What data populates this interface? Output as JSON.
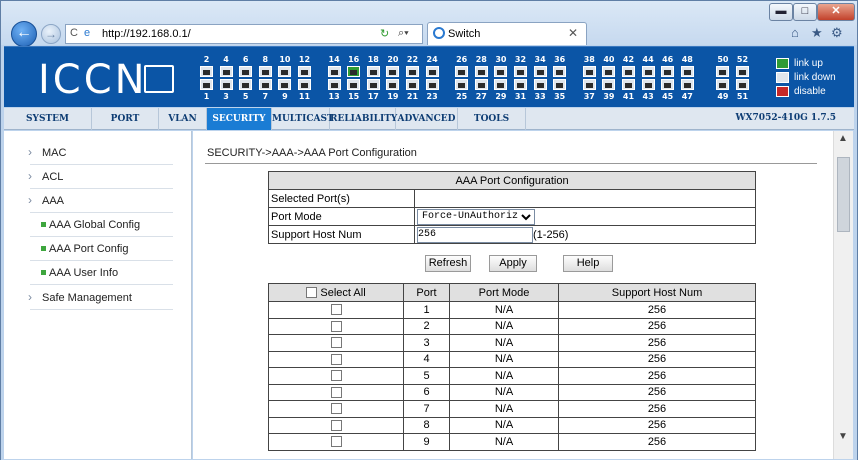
{
  "browser": {
    "url": "http://192.168.0.1/",
    "tab_title": "Switch",
    "min_label": "▬",
    "max_label": "□",
    "close_label": "✕"
  },
  "banner": {
    "logo": "ICCN",
    "top_ports": [
      "2",
      "4",
      "6",
      "8",
      "10",
      "12",
      "14",
      "16",
      "18",
      "20",
      "22",
      "24",
      "26",
      "28",
      "30",
      "32",
      "34",
      "36",
      "38",
      "40",
      "42",
      "44",
      "46",
      "48",
      "50",
      "52"
    ],
    "bottom_ports": [
      "1",
      "3",
      "5",
      "7",
      "9",
      "11",
      "13",
      "15",
      "17",
      "19",
      "21",
      "23",
      "25",
      "27",
      "29",
      "31",
      "33",
      "35",
      "37",
      "39",
      "41",
      "43",
      "45",
      "47",
      "49",
      "51"
    ],
    "legend": {
      "up": "link up",
      "down": "link down",
      "disable": "disable"
    }
  },
  "menu": {
    "items": [
      "SYSTEM",
      "PORT",
      "VLAN",
      "SECURITY",
      "MULTICAST",
      "RELIABILITY",
      "ADVANCED",
      "TOOLS"
    ],
    "active": "SECURITY",
    "version": "WX7052-410G 1.7.5"
  },
  "sidebar": {
    "mac": "MAC",
    "acl": "ACL",
    "aaa": "AAA",
    "aaa_global": "AAA Global Config",
    "aaa_port": "AAA Port Config",
    "aaa_user": "AAA User Info",
    "safe": "Safe Management"
  },
  "content": {
    "breadcrumb": "SECURITY->AAA->AAA Port Configuration",
    "cfg_title": "AAA Port Configuration",
    "selected_label": "Selected Port(s)",
    "selected_value": "",
    "mode_label": "Port Mode",
    "mode_value": "Force-UnAuthorized",
    "host_label": "Support Host Num",
    "host_value": "256",
    "host_range": "(1-256)",
    "refresh": "Refresh",
    "apply": "Apply",
    "help": "Help",
    "col_select": "Select All",
    "col_port": "Port",
    "col_mode": "Port Mode",
    "col_host": "Support Host Num",
    "rows": [
      {
        "port": "1",
        "mode": "N/A",
        "host": "256"
      },
      {
        "port": "2",
        "mode": "N/A",
        "host": "256"
      },
      {
        "port": "3",
        "mode": "N/A",
        "host": "256"
      },
      {
        "port": "4",
        "mode": "N/A",
        "host": "256"
      },
      {
        "port": "5",
        "mode": "N/A",
        "host": "256"
      },
      {
        "port": "6",
        "mode": "N/A",
        "host": "256"
      },
      {
        "port": "7",
        "mode": "N/A",
        "host": "256"
      },
      {
        "port": "8",
        "mode": "N/A",
        "host": "256"
      },
      {
        "port": "9",
        "mode": "N/A",
        "host": "256"
      }
    ]
  }
}
